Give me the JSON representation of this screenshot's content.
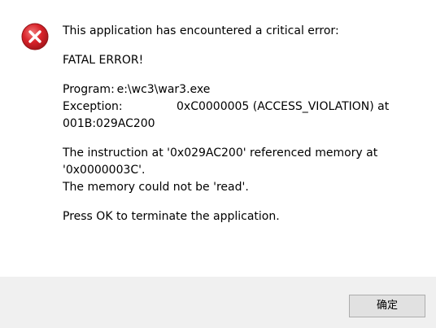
{
  "dialog": {
    "icon": "error-icon",
    "colors": {
      "icon_red": "#d9232a",
      "footer_bg": "#f0f0f0",
      "button_bg": "#e1e1e1",
      "button_border": "#adadad"
    },
    "header": "This application has encountered a critical error:",
    "fatal": "FATAL ERROR!",
    "program": "Program: e:\\wc3\\war3.exe",
    "exception_label": "Exception:",
    "exception_value": "0xC0000005 (ACCESS_VIOLATION) at",
    "exception_address": "001B:029AC200",
    "instruction_line1": "The instruction at '0x029AC200' referenced memory at",
    "instruction_line2": "'0x0000003C'.",
    "instruction_line3": "The memory could not be 'read'.",
    "press_ok": "Press OK to terminate the application.",
    "ok_label": "确定"
  }
}
